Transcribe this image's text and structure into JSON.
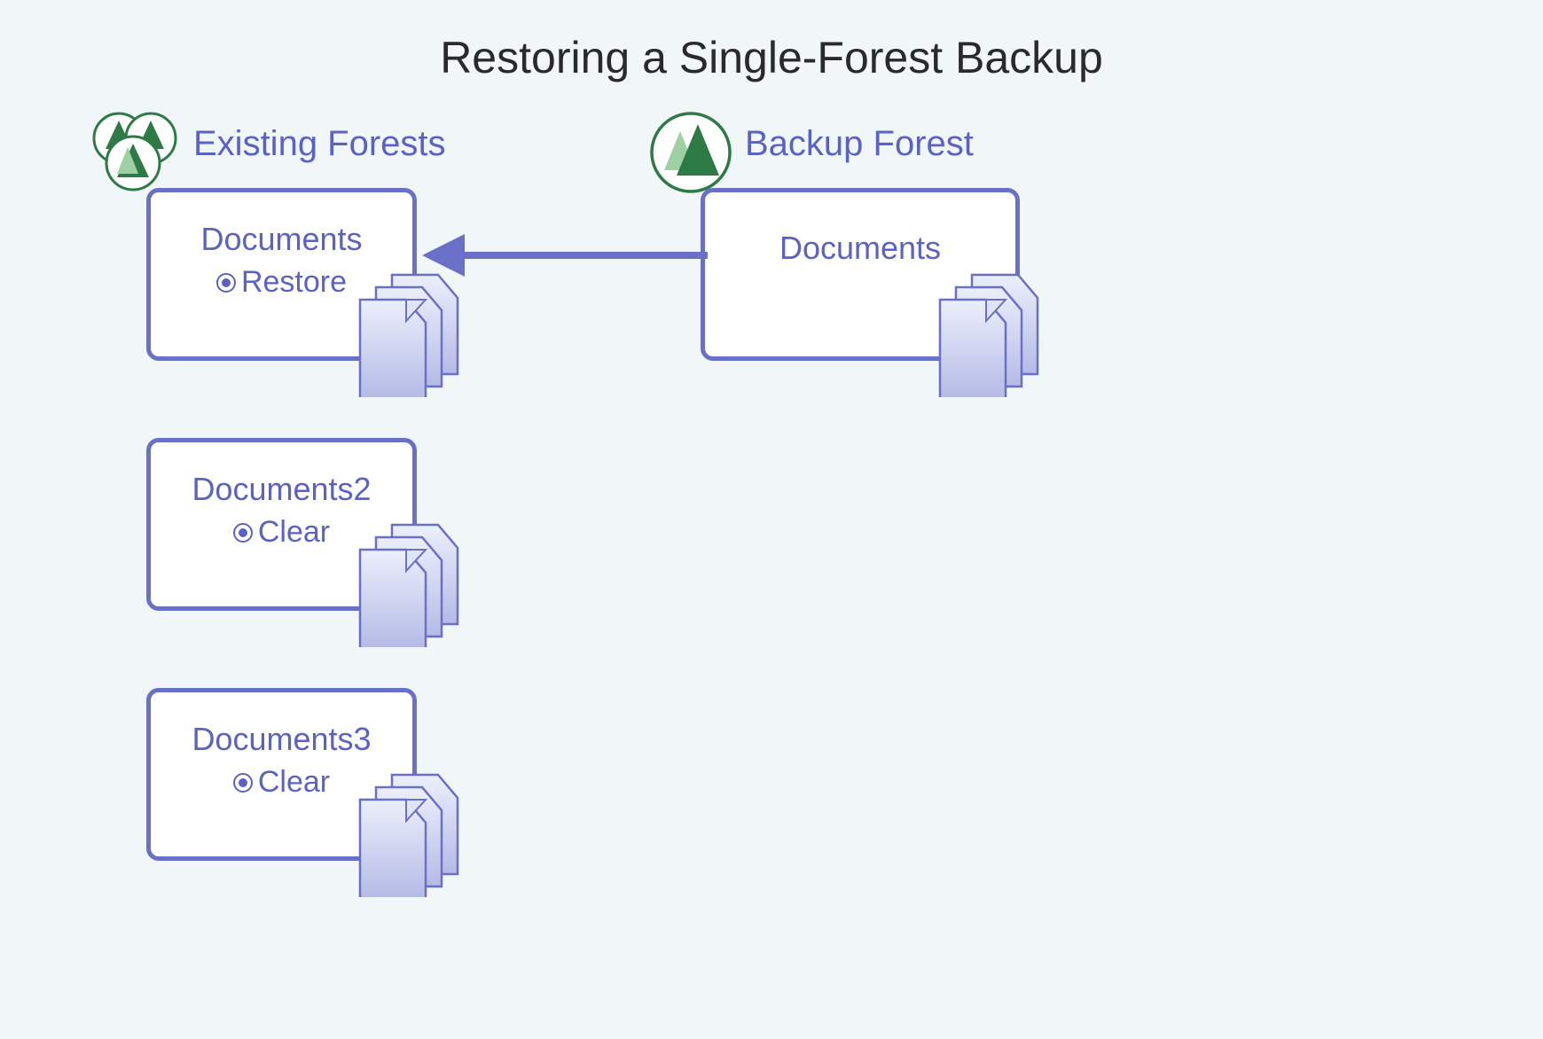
{
  "title": "Restoring a Single-Forest Backup",
  "colors": {
    "accent": "#5b62c4",
    "border": "#6a70c8",
    "forest_dark": "#2d7a46",
    "forest_light": "#9fcfa5",
    "doc_fill_top": "#eceffb",
    "doc_fill_bottom": "#b4bae6",
    "bg": "#f1f6f8"
  },
  "left_group": {
    "label": "Existing Forests",
    "icon": "forests-icon",
    "boxes": [
      {
        "title": "Documents",
        "radio_label": "Restore"
      },
      {
        "title": "Documents2",
        "radio_label": "Clear"
      },
      {
        "title": "Documents3",
        "radio_label": "Clear"
      }
    ]
  },
  "right_group": {
    "label": "Backup Forest",
    "icon": "forest-icon",
    "box": {
      "title": "Documents"
    }
  },
  "arrow": {
    "from": "backup-forest",
    "to": "existing-documents"
  }
}
